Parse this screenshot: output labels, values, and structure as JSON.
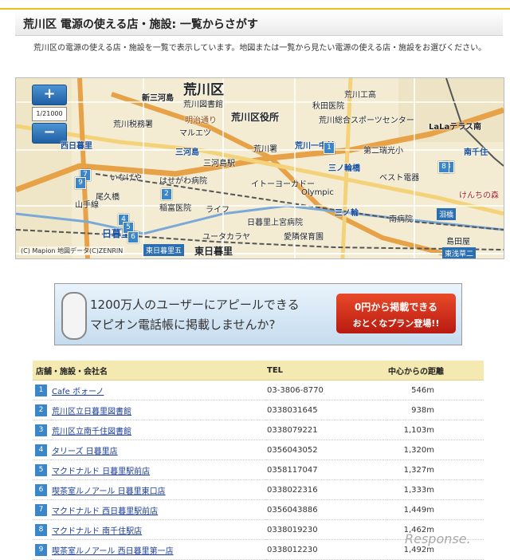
{
  "header": {
    "title": "荒川区 電源の使える店・施設: 一覧からさがす"
  },
  "description": "荒川区の電源の使える店・施設を一覧で表示しています。地図または一覧から見たい電源の使える店・施設をお選びください。",
  "map": {
    "zoom_in": "+",
    "zoom_out": "−",
    "zoom_level": "1/21000",
    "copyright": "(C) Mapion 地図データ(C)ZENRIN",
    "labels": {
      "arakawaku": "荒川区",
      "shinmikawajima": "新三河島",
      "arakawa_library": "荒川図書館",
      "arakawa_zeimusho": "荒川税務署",
      "meijidori": "明治通り",
      "marueitsu": "マルエツ",
      "arakawa_kuyakusho": "荒川区役所",
      "akita_hospital": "秋田医院",
      "arakawa_kosho": "荒川工高",
      "sports_center": "荒川総合スポーツセンター",
      "lalaterrace": "LaLaテラス南",
      "nishinippori": "西日暮里",
      "mikawajima": "三河島",
      "arakawasho": "荒川署",
      "arakawa_itchumae": "荒川一中前",
      "dainizuiko": "第二瑞光小",
      "minamisenju": "南千住",
      "minowa": "三ノ輪橋",
      "inageya": "いなげや",
      "hasegawa": "はせがわ病院",
      "itoyokado": "イトーヨーカドー",
      "olympic": "Olympic",
      "bestdenki": "ベスト電器",
      "oguhashi": "尾久橋",
      "inatomi": "稲富医院",
      "mikawajima_st": "三河島駅",
      "life": "ライフ",
      "nippori_kamimiya": "日暮里上宮病院",
      "minowa2": "三ノ輪",
      "namihashi": "泪橋",
      "yunitakarada": "ユータカラヤ",
      "aiwa": "愛隣保育園",
      "higashinippori": "東日暮里",
      "nippori": "日暮里",
      "higashinippori5": "東日暮里五",
      "higashiasakusa": "東浅草二",
      "yamanote": "山手線",
      "kenchino": "けんちの森",
      "minamisenju_hosp": "南病院",
      "shimadaya": "島田屋"
    }
  },
  "banner": {
    "line1": "1200万人のユーザーにアピールできる",
    "line2": "マピオン電話帳に掲載しませんか?",
    "cta1": "0円から掲載できる",
    "cta2": "おとくなプラン登場!!"
  },
  "table": {
    "headers": {
      "name": "店舗・施設・会社名",
      "tel": "TEL",
      "distance": "中心からの距離"
    },
    "rows": [
      {
        "num": "1",
        "name": "Cafe ボォーノ",
        "tel": "03-3806-8770",
        "distance": "546m"
      },
      {
        "num": "2",
        "name": "荒川区立日暮里図書館",
        "tel": "0338031645",
        "distance": "938m"
      },
      {
        "num": "3",
        "name": "荒川区立南千住図書館",
        "tel": "0338079221",
        "distance": "1,103m"
      },
      {
        "num": "4",
        "name": "タリーズ 日暮里店",
        "tel": "0356043052",
        "distance": "1,320m"
      },
      {
        "num": "5",
        "name": "マクドナルド 日暮里駅前店",
        "tel": "0358117047",
        "distance": "1,327m"
      },
      {
        "num": "6",
        "name": "喫茶室ルノアール 日暮里東口店",
        "tel": "0338022316",
        "distance": "1,333m"
      },
      {
        "num": "7",
        "name": "マクドナルド 西日暮里駅前店",
        "tel": "0356043886",
        "distance": "1,449m"
      },
      {
        "num": "8",
        "name": "マクドナルド 南千住駅店",
        "tel": "0338019230",
        "distance": "1,462m"
      },
      {
        "num": "9",
        "name": "喫茶室ルノアール 西日暮里第一店",
        "tel": "0338012230",
        "distance": "1,492m"
      }
    ]
  },
  "watermark": "Response."
}
